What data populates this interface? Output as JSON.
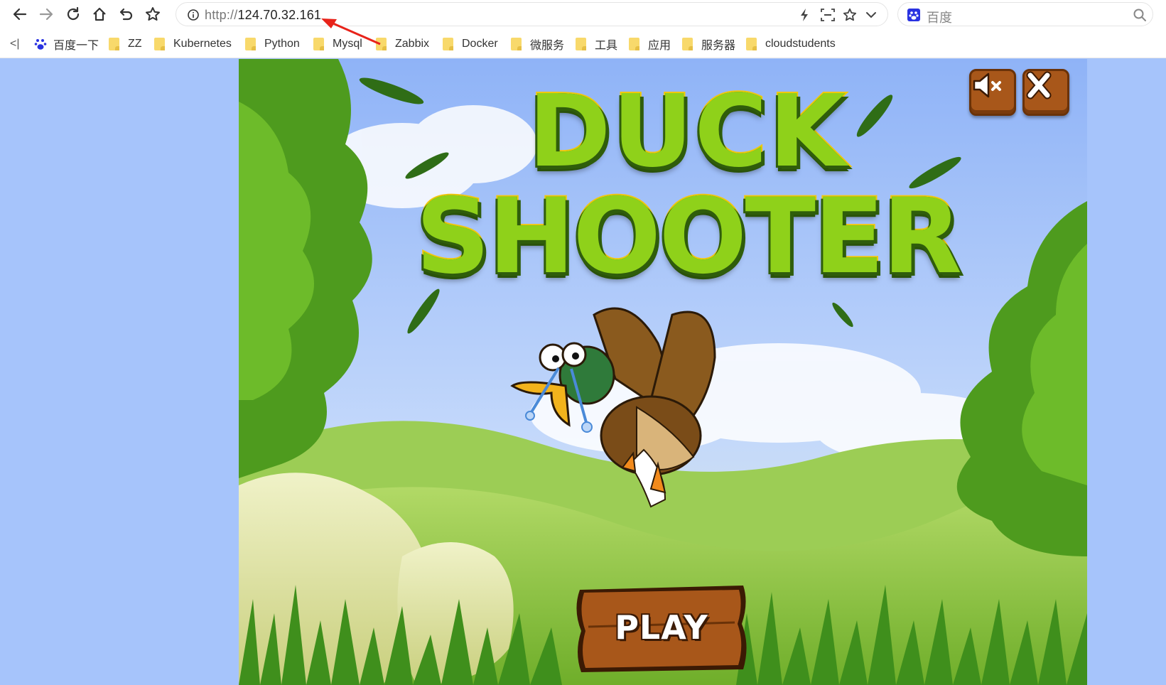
{
  "browser": {
    "url_scheme": "http://",
    "url_host": "124.70.32.161",
    "search_engine_placeholder": "百度",
    "nav_icons": [
      "back-icon",
      "forward-icon",
      "reload-icon",
      "home-icon",
      "undo-icon",
      "star-icon"
    ],
    "address_icons": [
      "lightning-icon",
      "screenshot-icon",
      "star-icon",
      "chevron-down-icon"
    ]
  },
  "bookmarks": {
    "collapse_label": "<|",
    "items": [
      {
        "label": "百度一下",
        "icon": "baidu-paw-icon"
      },
      {
        "label": "ZZ",
        "icon": "folder-icon"
      },
      {
        "label": "Kubernetes",
        "icon": "folder-icon"
      },
      {
        "label": "Python",
        "icon": "folder-icon"
      },
      {
        "label": "Mysql",
        "icon": "folder-icon"
      },
      {
        "label": "Zabbix",
        "icon": "folder-icon"
      },
      {
        "label": "Docker",
        "icon": "folder-icon"
      },
      {
        "label": "微服务",
        "icon": "folder-icon"
      },
      {
        "label": "工具",
        "icon": "folder-icon"
      },
      {
        "label": "应用",
        "icon": "folder-icon"
      },
      {
        "label": "服务器",
        "icon": "folder-icon"
      },
      {
        "label": "cloudstudents",
        "icon": "folder-icon"
      }
    ]
  },
  "game": {
    "title_line1": "DUCK",
    "title_line2": "SHOOTER",
    "play_label": "PLAY",
    "mute_button_icon": "speaker-mute-icon",
    "close_button_icon": "close-icon",
    "colors": {
      "sky": "#a6c4fb",
      "title_green": "#8fd11a",
      "title_outline": "#f2c80c",
      "wood": "#a8571a",
      "annotation_arrow": "#e8231a"
    }
  }
}
